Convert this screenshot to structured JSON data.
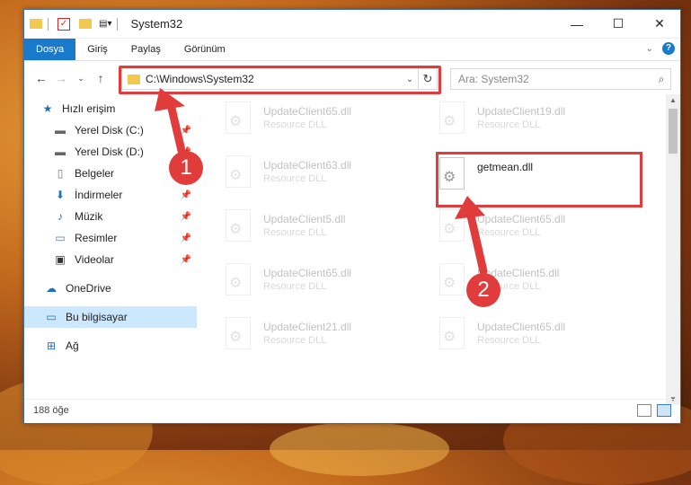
{
  "window": {
    "title": "System32"
  },
  "window_buttons": {
    "minimize": "—",
    "maximize": "☐",
    "close": "✕"
  },
  "ribbon": {
    "tabs": [
      "Dosya",
      "Giriş",
      "Paylaş",
      "Görünüm"
    ],
    "active": "Dosya",
    "help": "?"
  },
  "address": {
    "path": "C:\\Windows\\System32",
    "refresh": "↻"
  },
  "search": {
    "placeholder": "Ara: System32"
  },
  "sidebar": {
    "items": [
      {
        "label": "Hızlı erişim",
        "icon": "star-icon"
      },
      {
        "label": "Yerel Disk (C:)",
        "icon": "drive-icon",
        "pinned": true
      },
      {
        "label": "Yerel Disk (D:)",
        "icon": "drive-icon",
        "pinned": true
      },
      {
        "label": "Belgeler",
        "icon": "document-icon",
        "pinned": true
      },
      {
        "label": "İndirmeler",
        "icon": "download-icon",
        "pinned": true
      },
      {
        "label": "Müzik",
        "icon": "music-icon",
        "pinned": true
      },
      {
        "label": "Resimler",
        "icon": "picture-icon",
        "pinned": true
      },
      {
        "label": "Videolar",
        "icon": "video-icon",
        "pinned": true
      },
      {
        "label": "OneDrive",
        "icon": "cloud-icon"
      },
      {
        "label": "Bu bilgisayar",
        "icon": "computer-icon",
        "selected": true
      },
      {
        "label": "Ağ",
        "icon": "network-icon"
      }
    ]
  },
  "files": [
    {
      "name": "UpdateClient65.dll",
      "desc": "Resource DLL",
      "faded": true
    },
    {
      "name": "UpdateClient19.dll",
      "desc": "Resource DLL",
      "faded": true
    },
    {
      "name": "UpdateClient63.dll",
      "desc": "Resource DLL",
      "faded": true
    },
    {
      "name": "getmean.dll",
      "desc": "",
      "faded": false
    },
    {
      "name": "UpdateClient5.dll",
      "desc": "Resource DLL",
      "faded": true
    },
    {
      "name": "UpdateClient65.dll",
      "desc": "Resource DLL",
      "faded": true
    },
    {
      "name": "UpdateClient65.dll",
      "desc": "Resource DLL",
      "faded": true
    },
    {
      "name": "UpdateClient5.dll",
      "desc": "Resource DLL",
      "faded": true
    },
    {
      "name": "UpdateClient21.dll",
      "desc": "Resource DLL",
      "faded": true
    },
    {
      "name": "UpdateClient65.dll",
      "desc": "Resource DLL",
      "faded": true
    }
  ],
  "status": {
    "count": "188 öğe"
  },
  "callouts": [
    "1",
    "2"
  ],
  "colors": {
    "accent": "#1979ca",
    "highlight": "#e03c3c",
    "selected": "#cce8ff"
  }
}
